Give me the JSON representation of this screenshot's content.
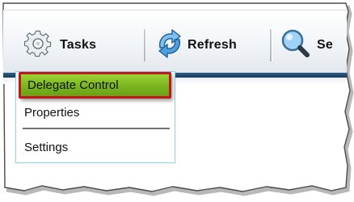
{
  "toolbar": {
    "tasks_label": "Tasks",
    "refresh_label": "Refresh",
    "search_label": "Se"
  },
  "menu": {
    "items": [
      {
        "label": "Delegate Control",
        "highlighted": true
      },
      {
        "label": "Properties",
        "highlighted": false
      },
      {
        "label": "Settings",
        "highlighted": false
      }
    ]
  },
  "colors": {
    "highlight_fill": "#7ab51f",
    "highlight_border": "#c2171c",
    "menu_border": "#8ad4e8",
    "toolbar_strip": "#1f4a6e"
  },
  "icons": [
    "gear-icon",
    "refresh-icon",
    "magnifier-icon"
  ]
}
